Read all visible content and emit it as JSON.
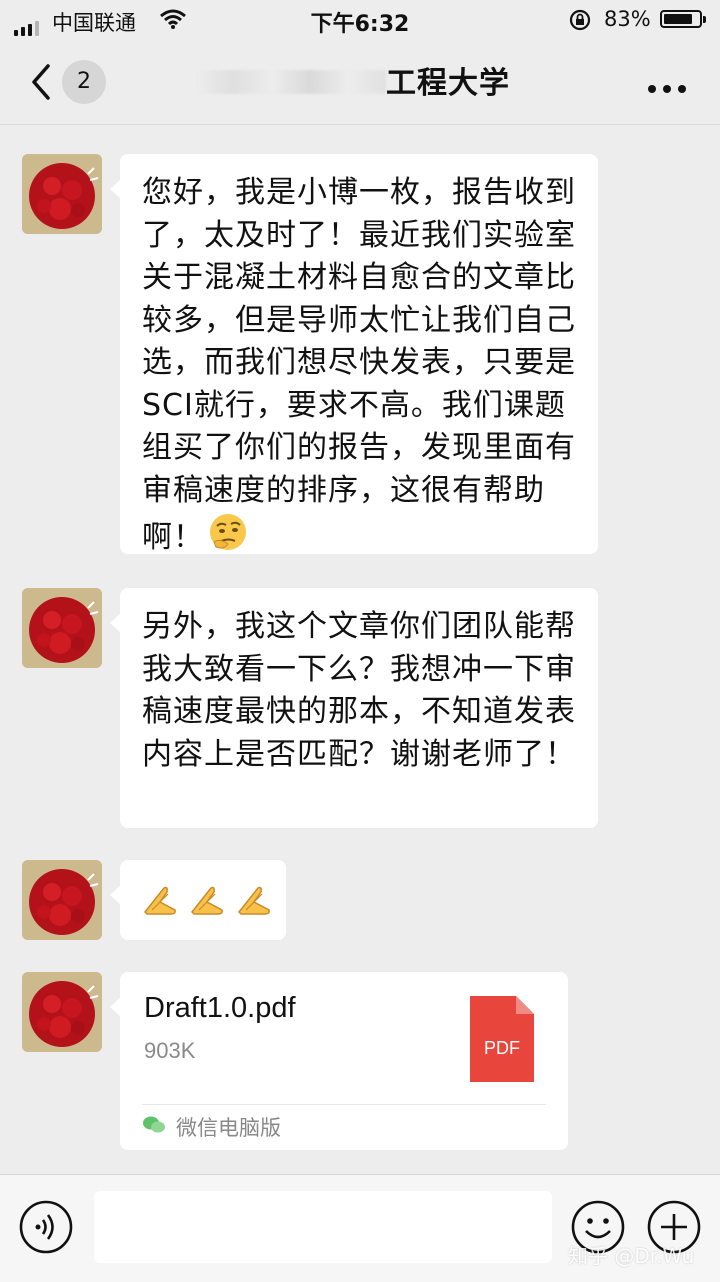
{
  "status_bar": {
    "carrier": "中国联通",
    "time": "下午6:32",
    "battery_percent": "83%",
    "battery_level": 0.83,
    "signal_bars": 3
  },
  "nav": {
    "unread_count": "2",
    "chat_title": "工程大学",
    "back_icon": "chevron-left-icon",
    "more_icon": "more-dots-icon"
  },
  "messages": [
    {
      "type": "text",
      "text": "您好，我是小博一枚，报告收到了，太及时了！最近我们实验室关于混凝土材料自愈合的文章比较多，但是导师太忙让我们自己选，而我们想尽快发表，只要是SCI就行，要求不高。我们课题组买了你们的报告，发现里面有审稿速度的排序，这很有帮助啊！",
      "emoji": "thinking-face-emoji"
    },
    {
      "type": "text",
      "text": "另外，我这个文章你们团队能帮我大致看一下么？我想冲一下审稿速度最快的那本，不知道发表内容上是否匹配？谢谢老师了！"
    },
    {
      "type": "emoji",
      "emoji": "folded-hands-emoji",
      "count": 3
    },
    {
      "type": "file",
      "file_name": "Draft1.0.pdf",
      "file_size": "903K",
      "file_type": "PDF",
      "source": "微信电脑版"
    }
  ],
  "input_bar": {
    "voice_icon": "voice-icon",
    "emoji_icon": "smile-icon",
    "plus_icon": "plus-circle-icon"
  },
  "watermark": "知乎 @Dr.Wu",
  "colors": {
    "background": "#ededed",
    "bubble": "#ffffff",
    "pdf_red": "#e8453c"
  }
}
